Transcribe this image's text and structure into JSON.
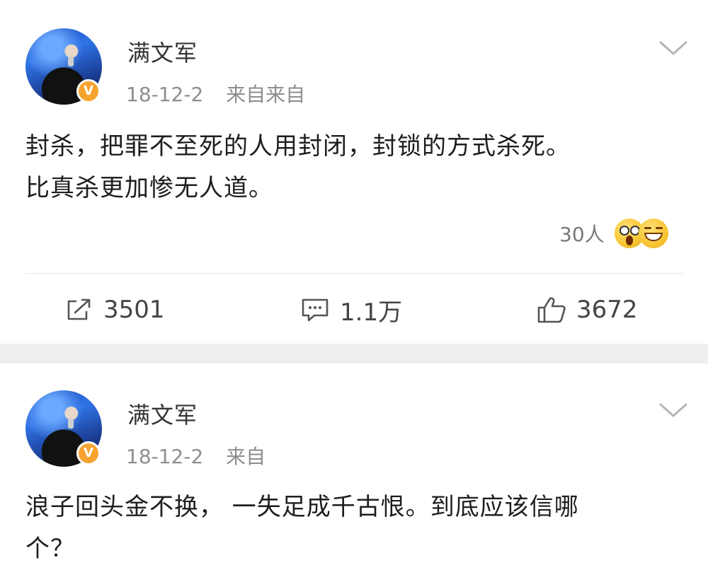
{
  "posts": [
    {
      "author": "满文军",
      "date": "18-12-2",
      "source": "来自来自",
      "text_line1": "封杀，把罪不至死的人用封闭，封锁的方式杀死。",
      "text_line2": "比真杀更加惨无人道。",
      "reaction_count": "30人",
      "repost_count": "3501",
      "comment_count": "1.1万",
      "like_count": "3672"
    },
    {
      "author": "满文军",
      "date": "18-12-2",
      "source": "来自",
      "text_line1": "浪子回头金不换， 一失足成千古恨。到底应该信哪",
      "text_line2": "个？"
    }
  ],
  "icons": {
    "verified": "verified-v-badge-icon",
    "more": "chevron-down-icon",
    "repost": "share-icon",
    "comment": "comment-icon",
    "like": "thumbs-up-icon",
    "emoji1": "surprised-emoji-icon",
    "emoji2": "laughing-emoji-icon"
  },
  "colors": {
    "verified_badge": "#f7a32f",
    "separator": "#eeeeee",
    "meta_text": "#8e8e8e"
  }
}
